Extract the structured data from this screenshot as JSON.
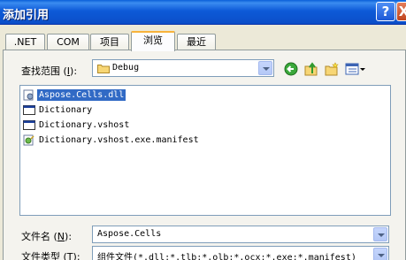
{
  "window": {
    "title": "添加引用",
    "help_label": "?",
    "close_label": "X"
  },
  "tabs": [
    {
      "label": ".NET"
    },
    {
      "label": "COM"
    },
    {
      "label": "项目"
    },
    {
      "label": "浏览",
      "active": true
    },
    {
      "label": "最近"
    }
  ],
  "look_in": {
    "label_prefix": "查找范围 (",
    "label_key": "I",
    "label_suffix": "):",
    "value": "Debug"
  },
  "toolbar": {
    "back_icon": "back-icon",
    "up_icon": "up-folder-icon",
    "new_folder_icon": "new-folder-icon",
    "view_icon": "view-menu-icon"
  },
  "files": [
    {
      "name": "Aspose.Cells.dll",
      "icon": "dll-icon",
      "selected": true
    },
    {
      "name": "Dictionary",
      "icon": "exe-icon"
    },
    {
      "name": "Dictionary.vshost",
      "icon": "exe-icon"
    },
    {
      "name": "Dictionary.vshost.exe.manifest",
      "icon": "manifest-icon"
    }
  ],
  "file_name": {
    "label_prefix": "文件名 (",
    "label_key": "N",
    "label_suffix": "):",
    "value": "Aspose.Cells"
  },
  "file_type": {
    "label_prefix": "文件类型 (",
    "label_key": "T",
    "label_suffix": "):",
    "value": "组件文件(*.dll;*.tlb;*.olb;*.ocx;*.exe;*.manifest)"
  },
  "colors": {
    "title_bar": "#0b4ec8",
    "selection": "#316ac5",
    "tab_highlight": "#f8b33b"
  }
}
